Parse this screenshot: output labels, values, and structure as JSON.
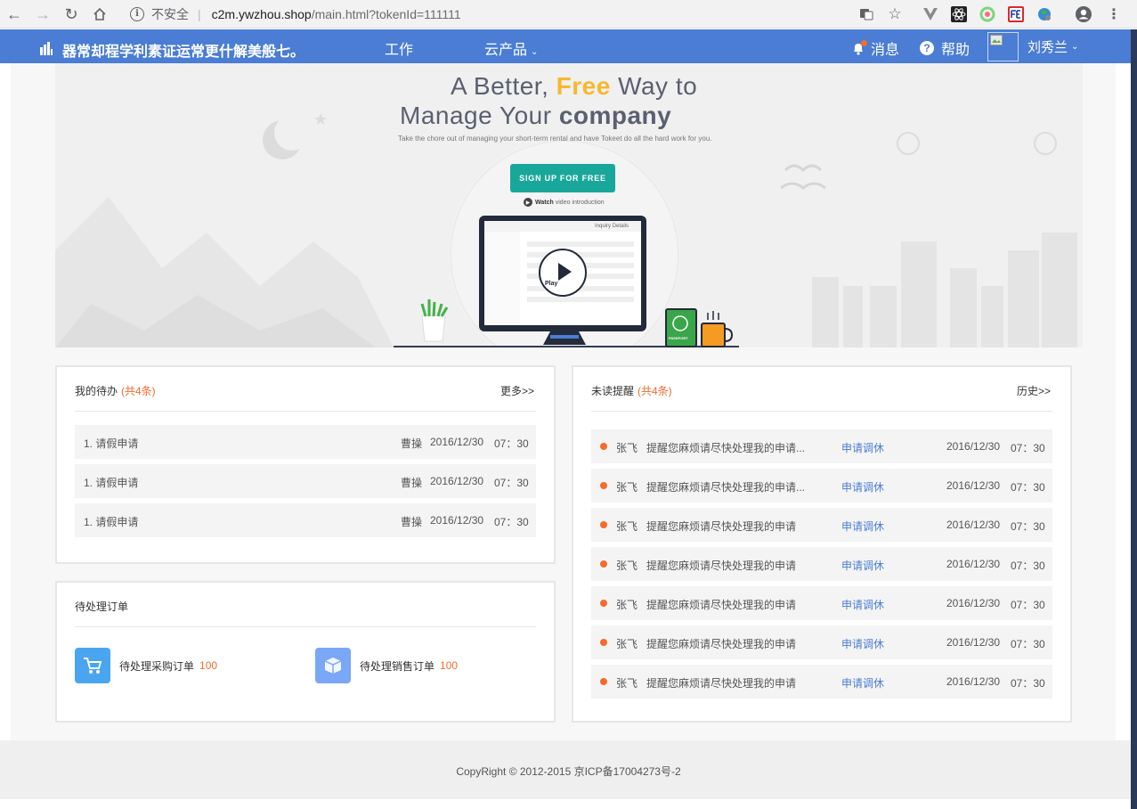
{
  "browser": {
    "insecure_label": "不安全",
    "url_host": "c2m.ywzhou.shop",
    "url_path": "/main.html?tokenId=111111"
  },
  "header": {
    "app_title": "器常却程学利素证运常更什解美般七。",
    "nav_work": "工作",
    "nav_cloud": "云产品",
    "messages": "消息",
    "help": "帮助",
    "user_name": "刘秀兰",
    "color": "#4a7dd3"
  },
  "hero": {
    "line1_pre": "A Better, ",
    "line1_free": "Free",
    "line1_post": " Way to",
    "line2_pre": "Manage Your ",
    "line2_company": "company",
    "subtitle": "Take the chore out of managing your short-term rental and have Tokeet do all the hard work for you.",
    "signup_button": "SIGN UP FOR FREE",
    "watch_bold": "Watch",
    "watch_rest": "video introduction",
    "play_label": "Play",
    "screen_header": "Inquiry Details",
    "passport_label": "PASSPORT"
  },
  "todo": {
    "title": "我的待办",
    "count": "(共4条)",
    "more": "更多>>",
    "items": [
      {
        "label": "1. 请假申请",
        "person": "曹操",
        "date": "2016/12/30",
        "time": "07：30"
      },
      {
        "label": "1. 请假申请",
        "person": "曹操",
        "date": "2016/12/30",
        "time": "07：30"
      },
      {
        "label": "1. 请假申请",
        "person": "曹操",
        "date": "2016/12/30",
        "time": "07：30"
      }
    ]
  },
  "orders": {
    "title": "待处理订单",
    "purchase_label": "待处理采购订单",
    "purchase_count": "100",
    "sales_label": "待处理销售订单",
    "sales_count": "100"
  },
  "reminders": {
    "title": "未读提醒",
    "count": "(共4条)",
    "history": "历史>>",
    "items": [
      {
        "person": "张飞",
        "message": "提醒您麻烦请尽快处理我的申请...",
        "link": "申请调休",
        "date": "2016/12/30",
        "time": "07：30"
      },
      {
        "person": "张飞",
        "message": "提醒您麻烦请尽快处理我的申请...",
        "link": "申请调休",
        "date": "2016/12/30",
        "time": "07：30"
      },
      {
        "person": "张飞",
        "message": "提醒您麻烦请尽快处理我的申请",
        "link": "申请调休",
        "date": "2016/12/30",
        "time": "07：30"
      },
      {
        "person": "张飞",
        "message": "提醒您麻烦请尽快处理我的申请",
        "link": "申请调休",
        "date": "2016/12/30",
        "time": "07：30"
      },
      {
        "person": "张飞",
        "message": "提醒您麻烦请尽快处理我的申请",
        "link": "申请调休",
        "date": "2016/12/30",
        "time": "07：30"
      },
      {
        "person": "张飞",
        "message": "提醒您麻烦请尽快处理我的申请",
        "link": "申请调休",
        "date": "2016/12/30",
        "time": "07：30"
      },
      {
        "person": "张飞",
        "message": "提醒您麻烦请尽快处理我的申请",
        "link": "申请调休",
        "date": "2016/12/30",
        "time": "07：30"
      }
    ]
  },
  "footer": {
    "copyright": "CopyRight © 2012-2015 京ICP备17004273号-2"
  }
}
